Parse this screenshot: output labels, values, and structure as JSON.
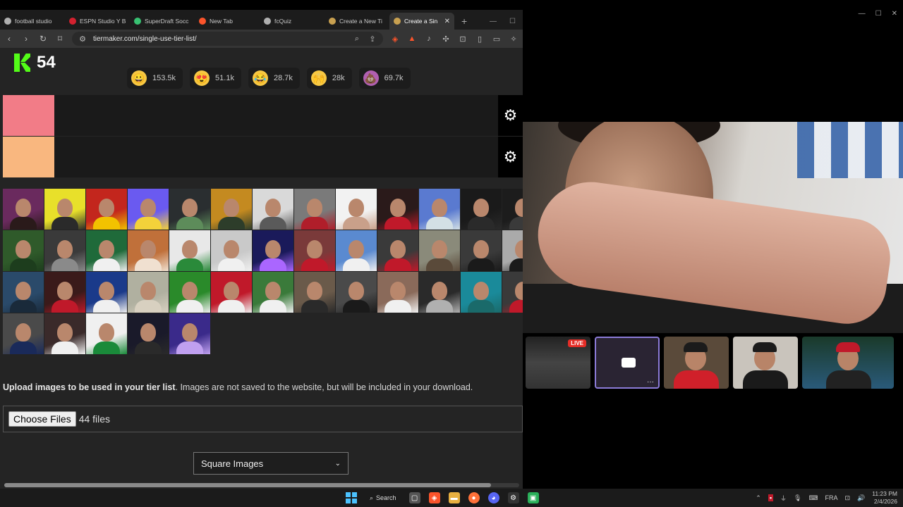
{
  "browser": {
    "tabs": [
      {
        "label": "football studio",
        "favicon_color": "#b0b0b0"
      },
      {
        "label": "ESPN Studio Y B",
        "favicon_color": "#d3212f"
      },
      {
        "label": "SuperDraft Socc",
        "favicon_color": "#38c172"
      },
      {
        "label": "New Tab",
        "favicon_color": "#fb542b"
      },
      {
        "label": "fcQuiz",
        "favicon_color": "#b0b0b0"
      },
      {
        "label": "Create a New Ti",
        "favicon_color": "#c8a050"
      },
      {
        "label": "Create a Sin",
        "favicon_color": "#c8a050",
        "active": true
      }
    ],
    "url": "tiermaker.com/single-use-tier-list/"
  },
  "kick": {
    "count": "54",
    "brand_color": "#53fc18"
  },
  "reactions": [
    {
      "icon": "grin-emoji-icon",
      "glyph": "😀",
      "color": "#f7c843",
      "count": "153.5k"
    },
    {
      "icon": "heart-eyes-emoji-icon",
      "glyph": "😍",
      "color": "#f7c843",
      "count": "51.1k"
    },
    {
      "icon": "laughing-emoji-icon",
      "glyph": "😂",
      "color": "#f7c843",
      "count": "28.7k"
    },
    {
      "icon": "raised-hands-emoji-icon",
      "glyph": "🙌",
      "color": "#f7c843",
      "count": "28k"
    },
    {
      "icon": "poop-emoji-icon",
      "glyph": "💩",
      "color": "#b05fb0",
      "count": "69.7k"
    }
  ],
  "tiers": [
    {
      "color": "#f27c87"
    },
    {
      "color": "#f9b77f"
    }
  ],
  "thumbs": [
    [
      "#6a2a5e",
      "#2a1a1a"
    ],
    [
      "#e8e02a",
      "#2a2a2a"
    ],
    [
      "#c3261d",
      "#f2c200"
    ],
    [
      "#6a5af0",
      "#f3d23a"
    ],
    [
      "#2a2e30",
      "#5d8c5a"
    ],
    [
      "#c48a20",
      "#2d3d2a"
    ],
    [
      "#d9d9d9",
      "#5a5a5a"
    ],
    [
      "#7a7a7a",
      "#b01e2a"
    ],
    [
      "#f2f2f2",
      "#c9a08a"
    ],
    [
      "#2a1a1a",
      "#c0192a"
    ],
    [
      "#5a7ad0",
      "#d3e0e5"
    ],
    [
      "#1a1a1a",
      "#2a2a2a"
    ],
    [
      "#1c1c1c",
      "#3a3a3a"
    ],
    [
      "#2f5a2a",
      "#1d3d1d"
    ],
    [
      "#3a3a3a",
      "#8a8a8a"
    ],
    [
      "#1f6a3a",
      "#f0f0f0"
    ],
    [
      "#c0703a",
      "#f0e0d0"
    ],
    [
      "#e8e8e8",
      "#2a8a3a"
    ],
    [
      "#c9c9c9",
      "#f0f0f0"
    ],
    [
      "#1a1a5a",
      "#aa66ff"
    ],
    [
      "#7a3a3a",
      "#c0192a"
    ],
    [
      "#5a8ad0",
      "#f0f0f0"
    ],
    [
      "#3a3a3a",
      "#c0192a"
    ],
    [
      "#8a8a7a",
      "#5a4a3a"
    ],
    [
      "#3a3a3a",
      "#1a1a1a"
    ],
    [
      "#aaaaaa",
      "#1a1a1a"
    ],
    [
      "#2a4a6a",
      "#1a2a3a"
    ],
    [
      "#3a1a1a",
      "#c0192a"
    ],
    [
      "#1a3a8a",
      "#f0f0f0"
    ],
    [
      "#b0b0a0",
      "#d8d0c0"
    ],
    [
      "#2a8a2a",
      "#f0f0f0"
    ],
    [
      "#c0192a",
      "#f0f0f0"
    ],
    [
      "#3a7a3a",
      "#f0f0f0"
    ],
    [
      "#6a5a4a",
      "#2a2a2a"
    ],
    [
      "#4a4a4a",
      "#1a1a1a"
    ],
    [
      "#8a6a5a",
      "#f0f0f0"
    ],
    [
      "#2a2a2a",
      "#b0b0b0"
    ],
    [
      "#1a8a9a",
      "#1a6a6a"
    ],
    [
      "#3a3a3a",
      "#c0192a"
    ],
    [
      "#4a4a4a",
      "#1a2a5a"
    ],
    [
      "#3a2a2a",
      "#f0f0f0"
    ],
    [
      "#f0f0f0",
      "#1a8a3a"
    ],
    [
      "#1a1a2a",
      "#2a2a2a"
    ],
    [
      "#3a2a8a",
      "#c0a0f0"
    ]
  ],
  "upload": {
    "bold_text": "Upload images to be used in your tier list",
    "rest_text": ". Images are not saved to the website, but will be included in your download.",
    "choose_label": "Choose Files",
    "file_count": "44 files",
    "select_value": "Square Images"
  },
  "call": {
    "live_label": "LIVE",
    "selected_color": "#8b7bd8"
  },
  "taskbar": {
    "search_label": "Search",
    "lang": "FRA",
    "time": "11:23 PM",
    "date": "2/4/2026"
  }
}
